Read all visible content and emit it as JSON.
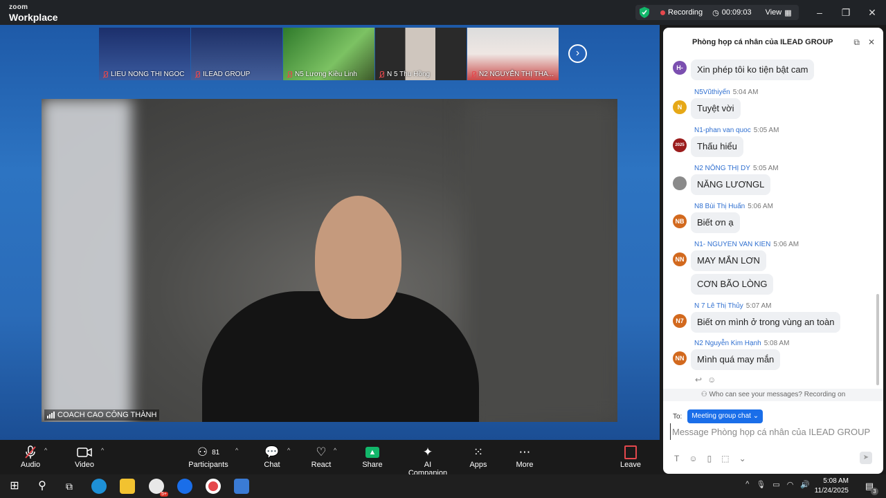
{
  "titlebar": {
    "brand_small": "zoom",
    "brand_large": "Workplace",
    "recording_label": "Recording",
    "timer": "00:09:03",
    "view_label": "View"
  },
  "thumbnails": [
    {
      "name": "LIEU NONG THI NGOC"
    },
    {
      "name": "ILEAD GROUP"
    },
    {
      "name": "N5 Lương Kiều Linh"
    },
    {
      "name": "N 5  Thu Hồng"
    },
    {
      "name": "N2 NGUYỄN THỊ THA..."
    }
  ],
  "main_video": {
    "speaker_name": "COACH CAO CÔNG THÀNH"
  },
  "chat": {
    "title": "Phòng họp cá nhân của ILEAD GROUP",
    "messages": [
      {
        "sender": "",
        "time": "",
        "avatar": "H-",
        "avatar_color": "#7b4fb0",
        "text": "Xin phép tôi ko tiện bật cam"
      },
      {
        "sender": "N5Vũthiyến",
        "time": "5:04 AM",
        "avatar": "N",
        "avatar_color": "#e6a817",
        "text": "Tuyệt vời"
      },
      {
        "sender": "N1-phan van quoc",
        "time": "5:05 AM",
        "avatar": "2025",
        "avatar_color": "#9b1c1c",
        "text": "Thấu hiểu"
      },
      {
        "sender": "N2 NÔNG THỊ DY",
        "time": "5:05 AM",
        "avatar": "",
        "avatar_color": "#777777",
        "text": "NĂNG LƯƠNGL"
      },
      {
        "sender": "N8 Bùi Thị Huấn",
        "time": "5:06 AM",
        "avatar": "NB",
        "avatar_color": "#d2691e",
        "text": "Biết ơn ạ"
      },
      {
        "sender": "N1- NGUYEN VAN KIEN",
        "time": "5:06 AM",
        "avatar": "NN",
        "avatar_color": "#d2691e",
        "text": "MAY MẮN LƠN"
      },
      {
        "sender": "",
        "time": "",
        "avatar": "",
        "avatar_color": "",
        "text": "CƠN BÃO LÒNG"
      },
      {
        "sender": "N 7 Lê Thị Thủy",
        "time": "5:07 AM",
        "avatar": "N7",
        "avatar_color": "#d2691e",
        "text": "Biết ơn mình ở trong vùng an toàn"
      },
      {
        "sender": "N2 Nguyễn Kim Hạnh",
        "time": "5:08 AM",
        "avatar": "NN",
        "avatar_color": "#d2691e",
        "text": "Mình quá may mắn"
      }
    ],
    "privacy_note": "Who can see your messages? Recording on",
    "to_label": "To:",
    "recipient": "Meeting group chat",
    "input_placeholder": "Message Phòng họp cá nhân của ILEAD GROUP"
  },
  "toolbar": {
    "audio": "Audio",
    "video": "Video",
    "participants": "Participants",
    "participants_count": "81",
    "chat": "Chat",
    "react": "React",
    "share": "Share",
    "ai_companion": "AI Companion",
    "apps": "Apps",
    "more": "More",
    "leave": "Leave"
  },
  "taskbar": {
    "time": "5:08 AM",
    "date": "11/24/2025",
    "notification_count": "3",
    "chrome_badge": "5+"
  },
  "colors": {
    "accent": "#1a6ee9",
    "recording": "#e5484d",
    "share": "#12b76a"
  }
}
